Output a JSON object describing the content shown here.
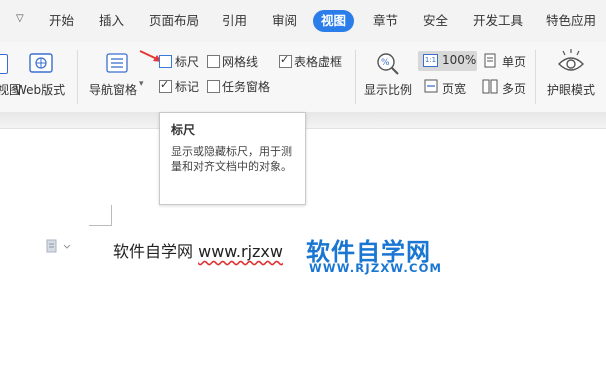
{
  "tabs": [
    {
      "label": "开始"
    },
    {
      "label": "插入"
    },
    {
      "label": "页面布局"
    },
    {
      "label": "引用"
    },
    {
      "label": "审阅"
    },
    {
      "label": "视图"
    },
    {
      "label": "章节"
    },
    {
      "label": "安全"
    },
    {
      "label": "开发工具"
    },
    {
      "label": "特色应用"
    }
  ],
  "active_tab": "视图",
  "ribbon": {
    "view_label": "视图",
    "web_layout": "Web版式",
    "nav_pane": "导航窗格",
    "ruler": "标尺",
    "gridlines": "网格线",
    "table_gridlines": "表格虚框",
    "markup": "标记",
    "task_pane": "任务窗格",
    "zoom_label": "显示比例",
    "zoom_value": "100%",
    "page_width": "页宽",
    "single_page": "单页",
    "multi_page": "多页",
    "eye_mode": "护眼模式"
  },
  "checkboxes": {
    "ruler": false,
    "gridlines": false,
    "table_gridlines": true,
    "markup": true,
    "task_pane": false
  },
  "tooltip": {
    "title": "标尺",
    "description": "显示或隐藏标尺，用于测量和对齐文档中的对象。"
  },
  "document": {
    "text": "软件自学网",
    "url": "www.rjzxw"
  },
  "watermark": {
    "title": "软件自学网",
    "url": "WWW.RJZXW.COM"
  },
  "colors": {
    "accent": "#2b7de9",
    "watermark": "#1976d2",
    "arrow": "#e53935"
  }
}
